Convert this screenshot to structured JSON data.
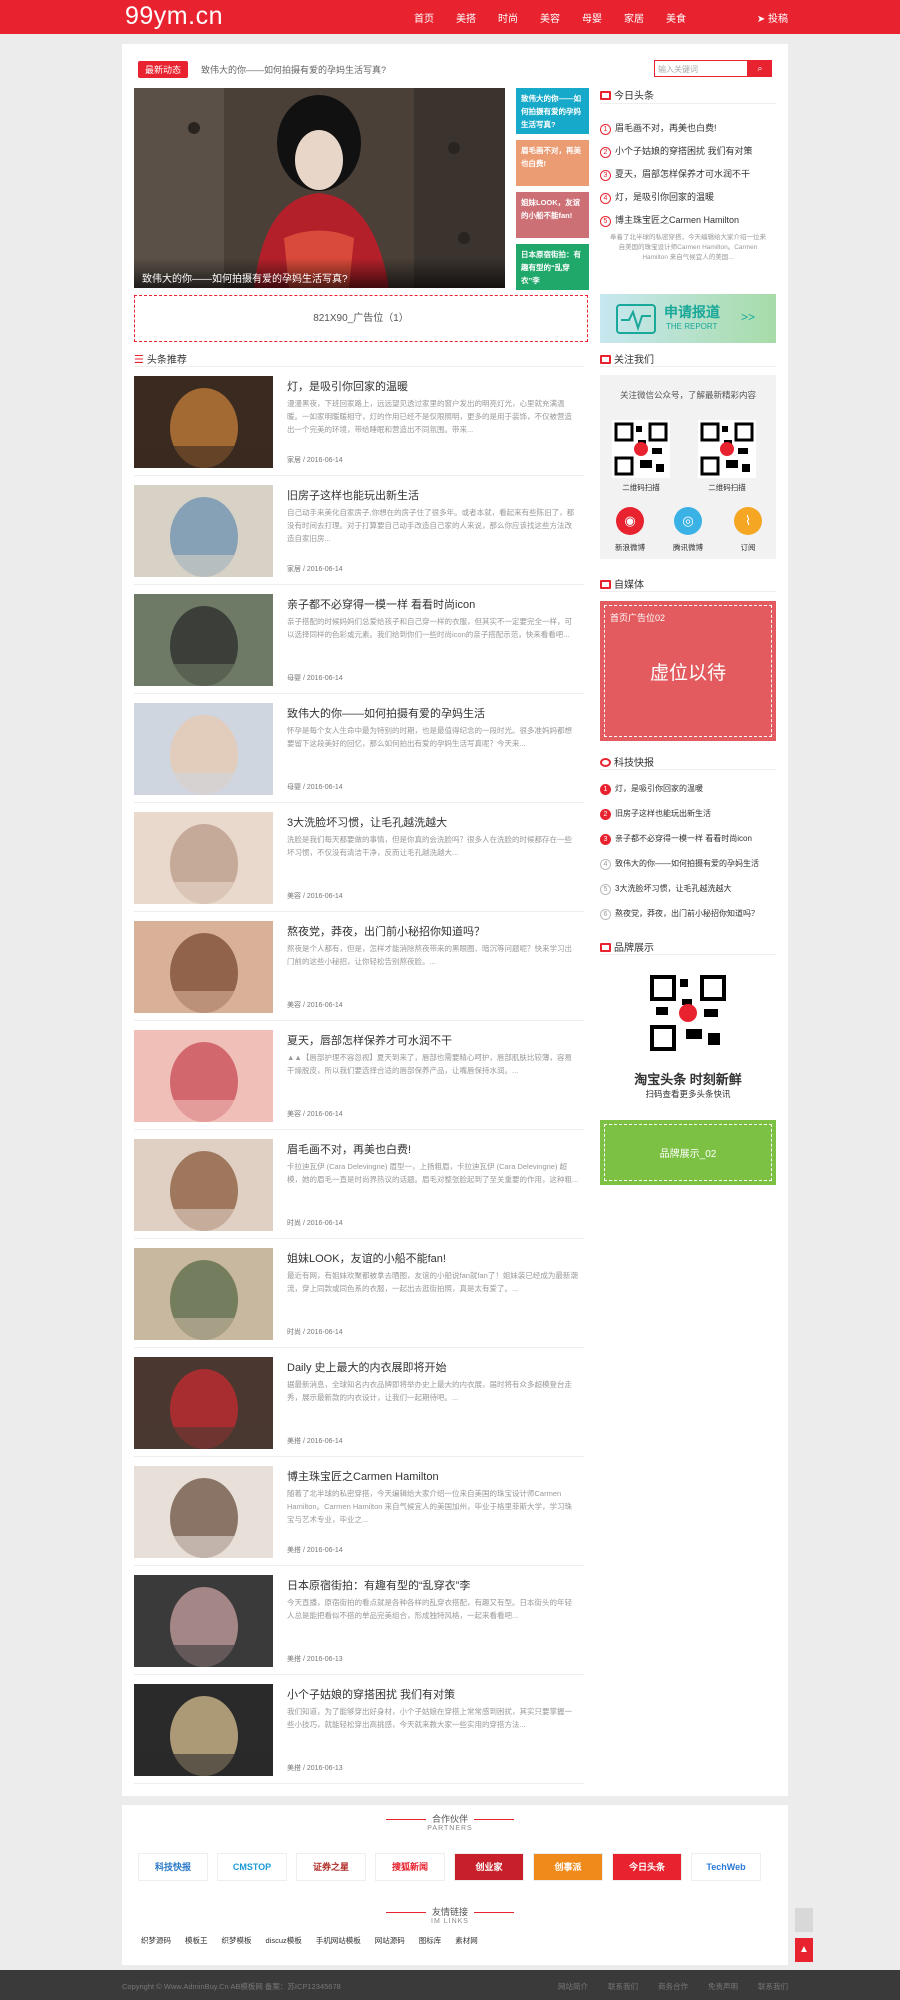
{
  "header": {
    "logo": "99ym.cn",
    "nav": [
      "首页",
      "美搭",
      "时尚",
      "美容",
      "母婴",
      "家居",
      "美食"
    ],
    "contribute": "投稿"
  },
  "ticker": {
    "badge": "最新动态",
    "text": "致伟大的你——如何拍摄有爱的孕妈生活写真?",
    "search_placeholder": "输入关键词",
    "search_btn": "搜"
  },
  "hero": {
    "caption": "致伟大的你——如何拍摄有爱的孕妈生活写真?"
  },
  "tiles": [
    {
      "text": "致伟大的你——如何拍摄有爱的孕妈生活写真?",
      "color": "#17a9c9"
    },
    {
      "text": "眉毛画不对，再美也白费!",
      "color": "#eb9c73"
    },
    {
      "text": "姐妹LOOK，友谊的小船不能fan!",
      "color": "#cd7076"
    },
    {
      "text": "日本原宿街拍：有趣有型的“乱穿衣”李",
      "color": "#1fa86a"
    }
  ],
  "today": {
    "title": "今日头条",
    "items": [
      "眉毛画不对，再美也白费!",
      "小个子姑娘的穿搭困扰 我们有对策",
      "夏天，眉部怎样保养才可水润不干",
      "灯，是吸引你回家的温暖",
      "博主珠宝匠之Carmen Hamilton"
    ],
    "summary": "奉着了北半球的私密穿搭，今天编辑给大家介绍一位来自美国的珠宝设计师Carmen Hamilton。Carmen Hamilton 来自气候宜人的美国..."
  },
  "ad1": "821X90_广告位（1）",
  "apply": {
    "title": "申请报道",
    "sub": "THE REPORT"
  },
  "recommend": {
    "title": "头条推荐"
  },
  "articles": [
    {
      "title": "灯，是吸引你回家的温暖",
      "excerpt": "漫漫黑夜，下班回家路上，远远望见透过家里的窗户发出的明亮灯光，心里就充满温暖。一如家明暖暖相守，灯的作用已经不是仅限照明，更多的是用于装饰，不仅被营造出一个完美的环境，带给睡眠和营造出不同氛围。带来...",
      "cat": "家居",
      "date": "2016-06-14"
    },
    {
      "title": "旧房子这样也能玩出新生活",
      "excerpt": "自己动手来美化自家房子,你想在的房子住了很多年。或者本就，看起来有些陈旧了，都没有时间去打理。对于打算要自己动手改造自己家的人来说，那么你应该找这些方法改造自家旧房...",
      "cat": "家居",
      "date": "2016-06-14"
    },
    {
      "title": "亲子都不必穿得一模一样 看看时尚icon",
      "excerpt": "亲子搭配的时候妈妈们总爱给孩子和自己穿一样的衣服，但其实不一定要完全一样，可以选择同样的色彩或元素。我们给到你们一些时尚icon的亲子搭配示范，快来看看吧...",
      "cat": "母婴",
      "date": "2016-06-14"
    },
    {
      "title": "致伟大的你——如何拍摄有爱的孕妈生活",
      "excerpt": "怀孕是每个女人生命中最为特别的时期，也是最值得纪念的一段时光。很多准妈妈都想要留下这段美好的回忆，那么如何拍出有爱的孕妈生活写真呢？今天来...",
      "cat": "母婴",
      "date": "2016-06-14"
    },
    {
      "title": "3大洗脸坏习惯，让毛孔越洗越大",
      "excerpt": "洗脸是我们每天都要做的事情，但是你真的会洗脸吗？很多人在洗脸的时候都存在一些坏习惯，不仅没有清洁干净，反而让毛孔越洗越大...",
      "cat": "美容",
      "date": "2016-06-14"
    },
    {
      "title": "熬夜党，莽夜，出门前小秘招你知道吗？",
      "excerpt": "熬夜是个人都有，但是，怎样才能消除熬夜带来的黑眼圈、暗沉等问题呢？快来学习出门前的这些小秘招，让你轻松告别熬夜脸。...",
      "cat": "美容",
      "date": "2016-06-14"
    },
    {
      "title": "夏天，唇部怎样保养才可水润不干",
      "excerpt": "▲▲【唇部护理不容忽视】夏天到来了，唇部也需要精心呵护，唇部肌肤比较薄，容易干燥脱皮，所以我们要选择合适的唇部保养产品，让嘴唇保持水润。...",
      "cat": "美容",
      "date": "2016-06-14"
    },
    {
      "title": "眉毛画不对，再美也白费!",
      "excerpt": "卡拉迪瓦伊 (Cara Delevingne) 眉型一，上扬粗眉，卡拉迪瓦伊 (Cara Delevingne) 超模，她的眉毛一直是时尚界热议的话题。眉毛对整张脸起到了至关重要的作用，这种粗...",
      "cat": "时尚",
      "date": "2016-06-14"
    },
    {
      "title": "姐妹LOOK，友谊的小船不能fan!",
      "excerpt": "最近有网，有姐妹欢聚都被拿去晒图，友谊的小船说fan就fan了！姐妹装已经成为最新潮流，穿上同款或同色系的衣服，一起出去逛街拍照，真是太有爱了。...",
      "cat": "时尚",
      "date": "2016-06-14"
    },
    {
      "title": "Daily 史上最大的内衣展即将开始",
      "excerpt": "据最新消息，全球知名内衣品牌即将举办史上最大的内衣展，届时将有众多超模登台走秀，展示最新款的内衣设计，让我们一起期待吧。...",
      "cat": "美搭",
      "date": "2016-06-14"
    },
    {
      "title": "博主珠宝匠之Carmen Hamilton",
      "excerpt": "随着了北半球的私密穿搭，今天编辑给大家介绍一位来自美国的珠宝设计师Carmen Hamilton。Carmen Hamilton 来自气候宜人的美国加州，毕业于格里菲斯大学，学习珠宝与艺术专业，毕业之...",
      "cat": "美搭",
      "date": "2016-06-14"
    },
    {
      "title": "日本原宿街拍：有趣有型的“乱穿衣”李",
      "excerpt": "今天直播，原宿街拍的看点就是各种各样的乱穿衣搭配，有趣又有型。日本街头的年轻人总是能把看似不搭的单品完美组合，形成独特风格，一起来看看吧...",
      "cat": "美搭",
      "date": "2016-06-13"
    },
    {
      "title": "小个子姑娘的穿搭困扰 我们有对策",
      "excerpt": "我们知道，为了能够穿出好身材，小个子姑娘在穿搭上常常感到困扰，其实只要掌握一些小技巧，就能轻松穿出高挑感，今天就来教大家一些实用的穿搭方法...",
      "cat": "美搭",
      "date": "2016-06-13"
    }
  ],
  "follow": {
    "title": "关注我们",
    "desc": "关注微信公众号，了解最新精彩内容",
    "qr1": "二维码扫描",
    "qr2": "二维码扫描",
    "social": [
      "新浪微博",
      "腾讯微博",
      "订阅"
    ]
  },
  "media": {
    "title": "自媒体",
    "ad_label": "首页广告位02",
    "ad_text": "虚位以待"
  },
  "tech": {
    "title": "科技快报",
    "items": [
      "灯，是吸引你回家的温暖",
      "旧房子这样也能玩出新生活",
      "亲子都不必穿得一模一样 看看时尚icon",
      "致伟大的你——如何拍摄有爱的孕妈生活",
      "3大洗脸坏习惯，让毛孔越洗越大",
      "熬夜党，莽夜，出门前小秘招你知道吗？"
    ]
  },
  "brand": {
    "title": "品牌展示",
    "slogan": "淘宝头条 时刻新鲜",
    "sub": "扫码查看更多头条快讯",
    "ad": "品牌展示_02"
  },
  "partners": {
    "title": "合作伙伴",
    "sub": "PARTNERS",
    "items": [
      "科技快报",
      "CMSTOP",
      "证券之星",
      "搜狐新闻",
      "创业家",
      "创事派",
      "今日头条",
      "TechWeb"
    ]
  },
  "links": {
    "title": "友情链接",
    "sub": "IM LINKS",
    "items": [
      "织梦源码",
      "模板王",
      "织梦模板",
      "discuz模板",
      "手机网站模板",
      "网站源码",
      "图标库",
      "素材网"
    ]
  },
  "footer": {
    "copy": "Copyright © Www.AdminBuy.Cn AB模板网 备案：苏ICP12345678",
    "links": [
      "网站简介",
      "联系我们",
      "商务合作",
      "免责声明",
      "联系我们"
    ]
  },
  "colors": {
    "brand": "#e8232f"
  }
}
